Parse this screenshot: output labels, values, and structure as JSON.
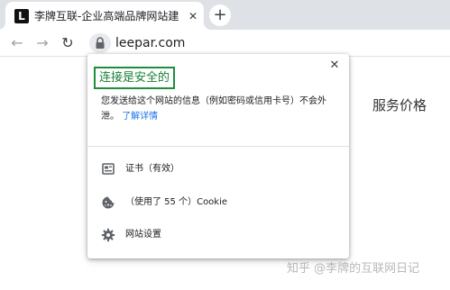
{
  "browser": {
    "tab": {
      "favicon_letter": "L",
      "title": "李牌互联-企业高端品牌网站建设",
      "close_glyph": "✕"
    },
    "new_tab_glyph": "+",
    "toolbar": {
      "back_glyph": "←",
      "forward_glyph": "→",
      "reload_glyph": "↻",
      "url": "leepar.com"
    }
  },
  "page": {
    "heading": "服务价格",
    "watermark": "知乎 @李牌的互联网日记"
  },
  "security_popup": {
    "close_glyph": "✕",
    "title": "连接是安全的",
    "description": "您发送给这个网站的信息（例如密码或信用卡号）不会外泄。",
    "learn_more": "了解详情",
    "items": [
      {
        "icon": "certificate-icon",
        "label": "证书（有效）"
      },
      {
        "icon": "cookie-icon",
        "label": "（使用了 55 个）Cookie"
      },
      {
        "icon": "gear-icon",
        "label": "网站设置"
      }
    ]
  },
  "colors": {
    "tabstrip_bg": "#dee1e6",
    "secure_green": "#188038",
    "link_blue": "#1a73e8"
  }
}
